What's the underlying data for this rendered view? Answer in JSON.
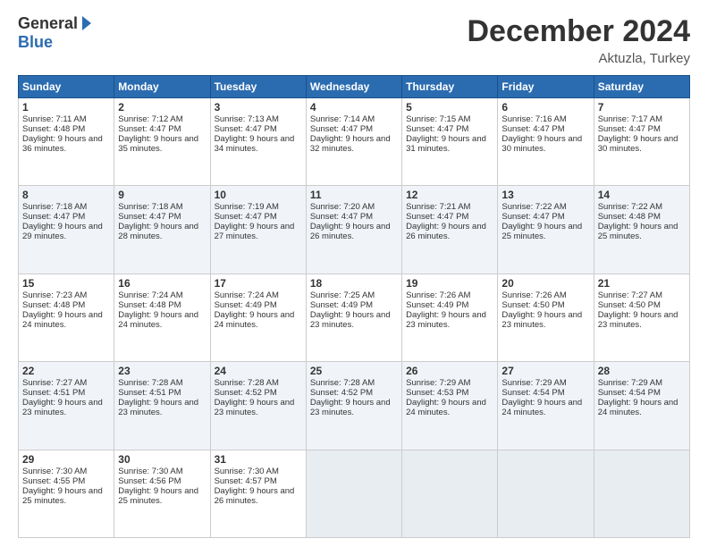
{
  "logo": {
    "general": "General",
    "blue": "Blue"
  },
  "title": "December 2024",
  "location": "Aktuzla, Turkey",
  "headers": [
    "Sunday",
    "Monday",
    "Tuesday",
    "Wednesday",
    "Thursday",
    "Friday",
    "Saturday"
  ],
  "weeks": [
    [
      {
        "day": "1",
        "sunrise": "Sunrise: 7:11 AM",
        "sunset": "Sunset: 4:48 PM",
        "daylight": "Daylight: 9 hours and 36 minutes."
      },
      {
        "day": "2",
        "sunrise": "Sunrise: 7:12 AM",
        "sunset": "Sunset: 4:47 PM",
        "daylight": "Daylight: 9 hours and 35 minutes."
      },
      {
        "day": "3",
        "sunrise": "Sunrise: 7:13 AM",
        "sunset": "Sunset: 4:47 PM",
        "daylight": "Daylight: 9 hours and 34 minutes."
      },
      {
        "day": "4",
        "sunrise": "Sunrise: 7:14 AM",
        "sunset": "Sunset: 4:47 PM",
        "daylight": "Daylight: 9 hours and 32 minutes."
      },
      {
        "day": "5",
        "sunrise": "Sunrise: 7:15 AM",
        "sunset": "Sunset: 4:47 PM",
        "daylight": "Daylight: 9 hours and 31 minutes."
      },
      {
        "day": "6",
        "sunrise": "Sunrise: 7:16 AM",
        "sunset": "Sunset: 4:47 PM",
        "daylight": "Daylight: 9 hours and 30 minutes."
      },
      {
        "day": "7",
        "sunrise": "Sunrise: 7:17 AM",
        "sunset": "Sunset: 4:47 PM",
        "daylight": "Daylight: 9 hours and 30 minutes."
      }
    ],
    [
      {
        "day": "8",
        "sunrise": "Sunrise: 7:18 AM",
        "sunset": "Sunset: 4:47 PM",
        "daylight": "Daylight: 9 hours and 29 minutes."
      },
      {
        "day": "9",
        "sunrise": "Sunrise: 7:18 AM",
        "sunset": "Sunset: 4:47 PM",
        "daylight": "Daylight: 9 hours and 28 minutes."
      },
      {
        "day": "10",
        "sunrise": "Sunrise: 7:19 AM",
        "sunset": "Sunset: 4:47 PM",
        "daylight": "Daylight: 9 hours and 27 minutes."
      },
      {
        "day": "11",
        "sunrise": "Sunrise: 7:20 AM",
        "sunset": "Sunset: 4:47 PM",
        "daylight": "Daylight: 9 hours and 26 minutes."
      },
      {
        "day": "12",
        "sunrise": "Sunrise: 7:21 AM",
        "sunset": "Sunset: 4:47 PM",
        "daylight": "Daylight: 9 hours and 26 minutes."
      },
      {
        "day": "13",
        "sunrise": "Sunrise: 7:22 AM",
        "sunset": "Sunset: 4:47 PM",
        "daylight": "Daylight: 9 hours and 25 minutes."
      },
      {
        "day": "14",
        "sunrise": "Sunrise: 7:22 AM",
        "sunset": "Sunset: 4:48 PM",
        "daylight": "Daylight: 9 hours and 25 minutes."
      }
    ],
    [
      {
        "day": "15",
        "sunrise": "Sunrise: 7:23 AM",
        "sunset": "Sunset: 4:48 PM",
        "daylight": "Daylight: 9 hours and 24 minutes."
      },
      {
        "day": "16",
        "sunrise": "Sunrise: 7:24 AM",
        "sunset": "Sunset: 4:48 PM",
        "daylight": "Daylight: 9 hours and 24 minutes."
      },
      {
        "day": "17",
        "sunrise": "Sunrise: 7:24 AM",
        "sunset": "Sunset: 4:49 PM",
        "daylight": "Daylight: 9 hours and 24 minutes."
      },
      {
        "day": "18",
        "sunrise": "Sunrise: 7:25 AM",
        "sunset": "Sunset: 4:49 PM",
        "daylight": "Daylight: 9 hours and 23 minutes."
      },
      {
        "day": "19",
        "sunrise": "Sunrise: 7:26 AM",
        "sunset": "Sunset: 4:49 PM",
        "daylight": "Daylight: 9 hours and 23 minutes."
      },
      {
        "day": "20",
        "sunrise": "Sunrise: 7:26 AM",
        "sunset": "Sunset: 4:50 PM",
        "daylight": "Daylight: 9 hours and 23 minutes."
      },
      {
        "day": "21",
        "sunrise": "Sunrise: 7:27 AM",
        "sunset": "Sunset: 4:50 PM",
        "daylight": "Daylight: 9 hours and 23 minutes."
      }
    ],
    [
      {
        "day": "22",
        "sunrise": "Sunrise: 7:27 AM",
        "sunset": "Sunset: 4:51 PM",
        "daylight": "Daylight: 9 hours and 23 minutes."
      },
      {
        "day": "23",
        "sunrise": "Sunrise: 7:28 AM",
        "sunset": "Sunset: 4:51 PM",
        "daylight": "Daylight: 9 hours and 23 minutes."
      },
      {
        "day": "24",
        "sunrise": "Sunrise: 7:28 AM",
        "sunset": "Sunset: 4:52 PM",
        "daylight": "Daylight: 9 hours and 23 minutes."
      },
      {
        "day": "25",
        "sunrise": "Sunrise: 7:28 AM",
        "sunset": "Sunset: 4:52 PM",
        "daylight": "Daylight: 9 hours and 23 minutes."
      },
      {
        "day": "26",
        "sunrise": "Sunrise: 7:29 AM",
        "sunset": "Sunset: 4:53 PM",
        "daylight": "Daylight: 9 hours and 24 minutes."
      },
      {
        "day": "27",
        "sunrise": "Sunrise: 7:29 AM",
        "sunset": "Sunset: 4:54 PM",
        "daylight": "Daylight: 9 hours and 24 minutes."
      },
      {
        "day": "28",
        "sunrise": "Sunrise: 7:29 AM",
        "sunset": "Sunset: 4:54 PM",
        "daylight": "Daylight: 9 hours and 24 minutes."
      }
    ],
    [
      {
        "day": "29",
        "sunrise": "Sunrise: 7:30 AM",
        "sunset": "Sunset: 4:55 PM",
        "daylight": "Daylight: 9 hours and 25 minutes."
      },
      {
        "day": "30",
        "sunrise": "Sunrise: 7:30 AM",
        "sunset": "Sunset: 4:56 PM",
        "daylight": "Daylight: 9 hours and 25 minutes."
      },
      {
        "day": "31",
        "sunrise": "Sunrise: 7:30 AM",
        "sunset": "Sunset: 4:57 PM",
        "daylight": "Daylight: 9 hours and 26 minutes."
      },
      null,
      null,
      null,
      null
    ]
  ]
}
